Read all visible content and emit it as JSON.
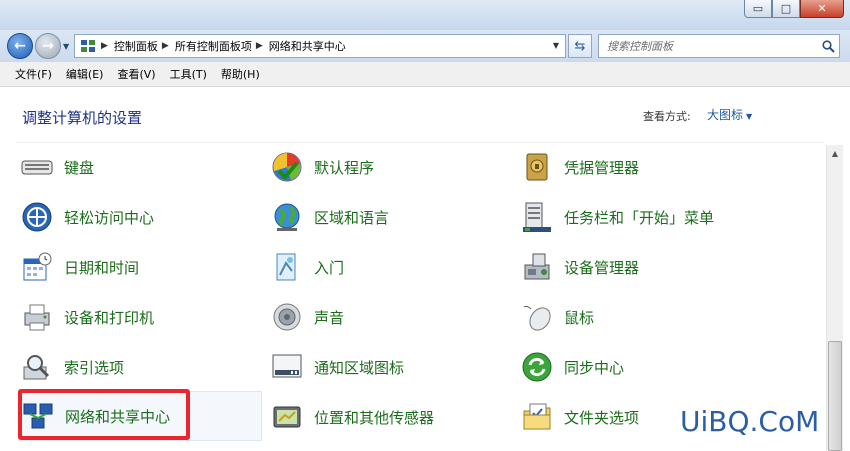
{
  "window": {
    "controls": {
      "minimize": "▭",
      "maximize": "□",
      "close": "✕"
    }
  },
  "address": {
    "breadcrumbs": [
      "控制面板",
      "所有控制面板项",
      "网络和共享中心"
    ],
    "search_placeholder": "搜索控制面板"
  },
  "menu": [
    "文件(F)",
    "编辑(E)",
    "查看(V)",
    "工具(T)",
    "帮助(H)"
  ],
  "content": {
    "title": "调整计算机的设置",
    "view_mode_label": "查看方式:",
    "view_mode_value": "大图标"
  },
  "items": [
    {
      "label": "键盘",
      "icon": "keyboard-icon"
    },
    {
      "label": "默认程序",
      "icon": "default-programs-icon"
    },
    {
      "label": "凭据管理器",
      "icon": "credential-manager-icon"
    },
    {
      "label": "轻松访问中心",
      "icon": "ease-of-access-icon"
    },
    {
      "label": "区域和语言",
      "icon": "globe-icon"
    },
    {
      "label": "任务栏和「开始」菜单",
      "icon": "taskbar-icon"
    },
    {
      "label": "日期和时间",
      "icon": "calendar-clock-icon"
    },
    {
      "label": "入门",
      "icon": "getting-started-icon"
    },
    {
      "label": "设备管理器",
      "icon": "device-manager-icon"
    },
    {
      "label": "设备和打印机",
      "icon": "printer-icon"
    },
    {
      "label": "声音",
      "icon": "speaker-icon"
    },
    {
      "label": "鼠标",
      "icon": "mouse-icon"
    },
    {
      "label": "索引选项",
      "icon": "indexing-icon"
    },
    {
      "label": "通知区域图标",
      "icon": "notification-area-icon"
    },
    {
      "label": "同步中心",
      "icon": "sync-center-icon"
    },
    {
      "label": "网络和共享中心",
      "icon": "network-icon"
    },
    {
      "label": "位置和其他传感器",
      "icon": "location-sensor-icon"
    },
    {
      "label": "文件夹选项",
      "icon": "folder-options-icon"
    }
  ],
  "watermark": "UiBQ.CoM",
  "colors": {
    "link_green": "#1b6d1b",
    "title_blue": "#1e3287",
    "highlight_red": "#e8262b"
  }
}
